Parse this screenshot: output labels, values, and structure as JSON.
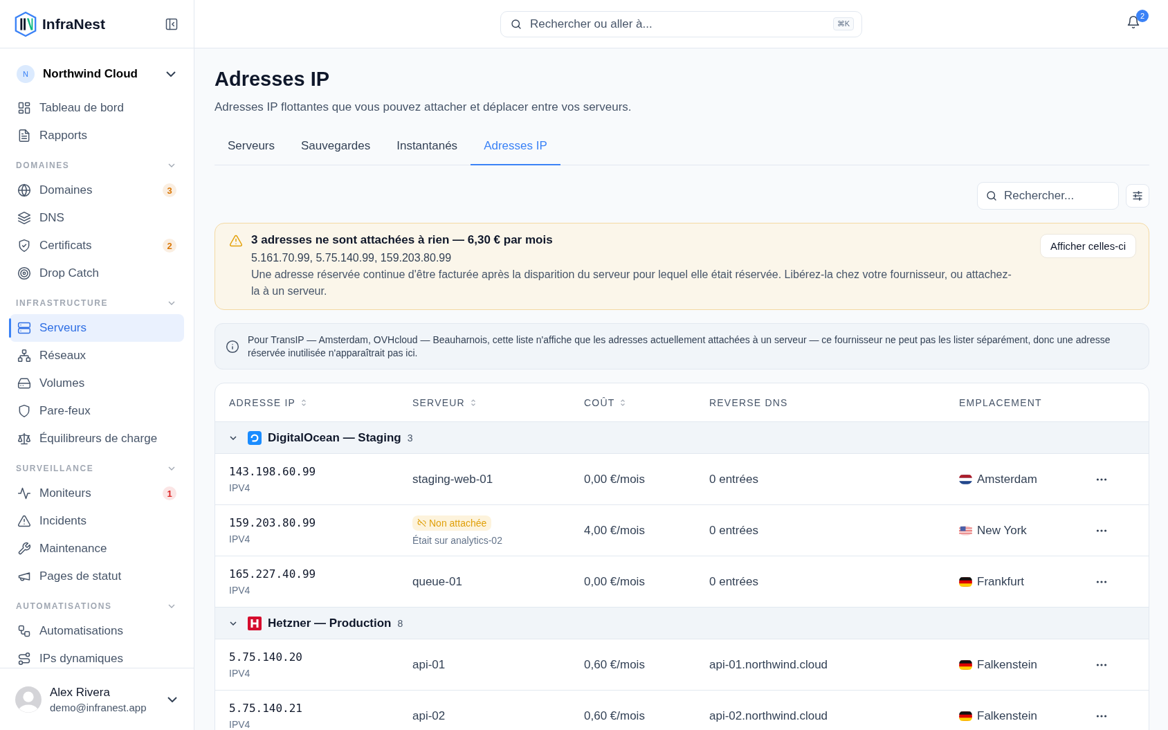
{
  "sidebar": {
    "logo": "InfraNest",
    "workspace": {
      "initial": "N",
      "name": "Northwind Cloud"
    },
    "top_items": [
      {
        "label": "Tableau de bord",
        "selected": false
      },
      {
        "label": "Rapports",
        "selected": false
      }
    ],
    "sections": [
      {
        "title": "DOMAINES",
        "expanded": true,
        "items": [
          {
            "label": "Domaines",
            "badge": "3",
            "color": "#d97706",
            "selected": false
          },
          {
            "label": "DNS",
            "selected": false
          },
          {
            "label": "Certificats",
            "badge": "2",
            "color": "#d97706",
            "selected": false
          },
          {
            "label": "Drop Catch",
            "selected": false
          }
        ]
      },
      {
        "title": "INFRASTRUCTURE",
        "expanded": true,
        "items": [
          {
            "label": "Serveurs",
            "selected": true
          },
          {
            "label": "Réseaux",
            "selected": false
          },
          {
            "label": "Volumes",
            "selected": false
          },
          {
            "label": "Pare-feux",
            "selected": false
          },
          {
            "label": "Équilibreurs de charge",
            "selected": false
          }
        ]
      },
      {
        "title": "SURVEILLANCE",
        "expanded": true,
        "items": [
          {
            "label": "Moniteurs",
            "badge": "1",
            "color": "#dc2626",
            "selected": false
          },
          {
            "label": "Incidents",
            "selected": false
          },
          {
            "label": "Maintenance",
            "selected": false
          },
          {
            "label": "Pages de statut",
            "selected": false
          }
        ]
      },
      {
        "title": "AUTOMATISATIONS",
        "expanded": true,
        "items": [
          {
            "label": "Automatisations",
            "selected": false
          },
          {
            "label": "IPs dynamiques",
            "selected": false
          }
        ]
      }
    ],
    "user": {
      "name": "Alex Rivera",
      "email": "demo@infranest.app"
    }
  },
  "header": {
    "search": {
      "placeholder": "Rechercher ou aller à...",
      "shortcut": "⌘K"
    },
    "notifications": "2"
  },
  "page": {
    "title": "Adresses IP",
    "subtitle": "Adresses IP flottantes que vous pouvez attacher et déplacer entre vos serveurs.",
    "tabs": [
      {
        "label": "Serveurs",
        "selected": false
      },
      {
        "label": "Sauvegardes",
        "selected": false
      },
      {
        "label": "Instantanés",
        "selected": false
      },
      {
        "label": "Adresses IP",
        "selected": true
      }
    ],
    "search": {
      "placeholder": "Rechercher..."
    },
    "alert": {
      "title": "3 adresses ne sont attachées à rien — 6,30 € par mois",
      "addresses": "5.161.70.99, 5.75.140.99, 159.203.80.99",
      "body": "Une adresse réservée continue d'être facturée après la disparition du serveur pour lequel elle était réservée. Libérez-la chez votre fournisseur, ou attachez-la à un serveur.",
      "button": "Afficher celles-ci"
    },
    "info": "Pour TransIP — Amsterdam, OVHcloud — Beauharnois, cette liste n'affiche que les adresses actuellement attachées à un serveur — ce fournisseur ne peut pas les lister séparément, donc une adresse réservée inutilisée n'apparaîtrait pas ici.",
    "table": {
      "columns": [
        {
          "label": "ADRESSE IP",
          "sortable": true
        },
        {
          "label": "SERVEUR",
          "sortable": true
        },
        {
          "label": "COÛT",
          "sortable": true
        },
        {
          "label": "REVERSE DNS",
          "sortable": false
        },
        {
          "label": "EMPLACEMENT",
          "sortable": false
        }
      ],
      "groups": [
        {
          "name": "DigitalOcean — Staging",
          "count": "3",
          "expanded": true,
          "rows": [
            {
              "ip": "143.198.60.99",
              "version": "IPV4",
              "kind": "attached",
              "server": "staging-web-01",
              "cost": "0,00 €/mois",
              "dns": "0 entrées",
              "location": "Amsterdam"
            },
            {
              "ip": "159.203.80.99",
              "version": "IPV4",
              "kind": "detached",
              "status": "Non attachée",
              "server": "Était sur analytics-02",
              "cost": "4,00 €/mois",
              "dns": "0 entrées",
              "location": "New York"
            },
            {
              "ip": "165.227.40.99",
              "version": "IPV4",
              "kind": "attached",
              "server": "queue-01",
              "cost": "0,00 €/mois",
              "dns": "0 entrées",
              "location": "Frankfurt"
            }
          ]
        },
        {
          "name": "Hetzner — Production",
          "count": "8",
          "expanded": true,
          "rows": [
            {
              "ip": "5.75.140.20",
              "version": "IPV4",
              "kind": "attached",
              "server": "api-01",
              "cost": "0,60 €/mois",
              "dns": "api-01.northwind.cloud",
              "location": "Falkenstein"
            },
            {
              "ip": "5.75.140.21",
              "version": "IPV4",
              "kind": "attached",
              "server": "api-02",
              "cost": "0,60 €/mois",
              "dns": "api-02.northwind.cloud",
              "location": "Falkenstein"
            }
          ]
        }
      ]
    }
  }
}
